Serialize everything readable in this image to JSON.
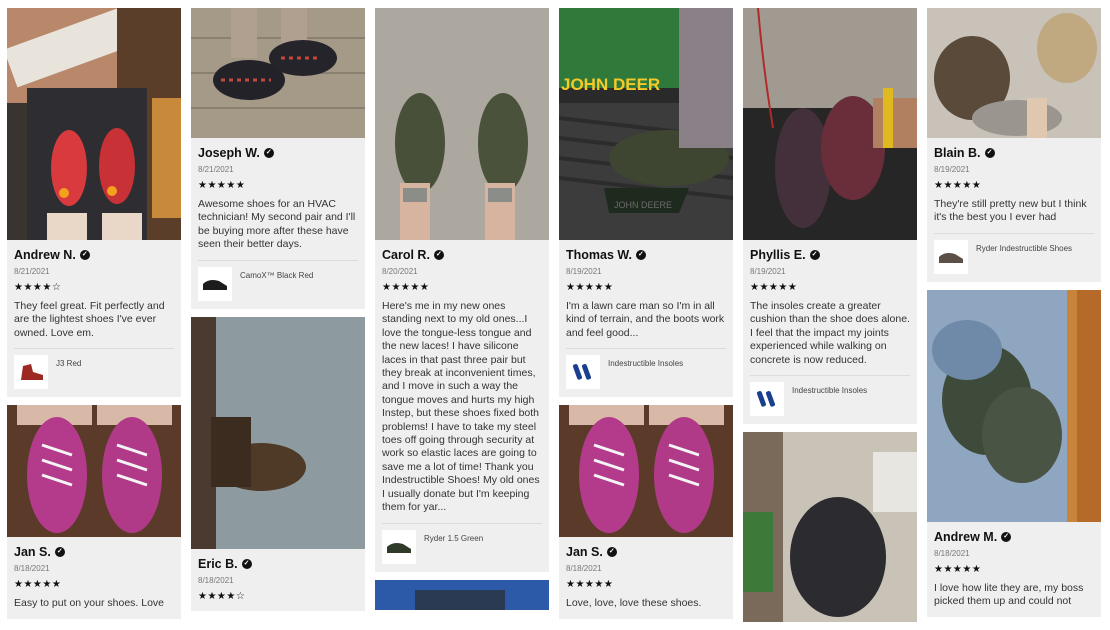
{
  "reviews": [
    {
      "name": "Andrew N.",
      "date": "8/21/2021",
      "stars": "★★★★☆",
      "text": "They feel great. Fit perfectly and are the lightest shoes I've ever owned. Love em.",
      "product": "J3 Red"
    },
    {
      "name": "Jan S.",
      "date": "8/18/2021",
      "stars": "★★★★★",
      "text": "Easy to put on your shoes. Love"
    },
    {
      "name": "Joseph W.",
      "date": "8/21/2021",
      "stars": "★★★★★",
      "text": "Awesome shoes for an HVAC technician! My second pair and I'll be buying more after these have seen their better days.",
      "product": "CamoX™ Black Red"
    },
    {
      "name": "Eric B.",
      "date": "8/18/2021",
      "stars": "★★★★☆"
    },
    {
      "name": "Carol R.",
      "date": "8/20/2021",
      "stars": "★★★★★",
      "text": "Here's me in my new ones standing next to my old ones...I love the tongue-less tongue and the new laces! I have silicone laces in that past three pair but they break at inconvenient times, and I move in such a way the tongue moves and hurts my high Instep, but these shoes fixed both problems! I have to take my steel toes off going through security at work so elastic laces are going to save me a lot of time! Thank you Indestructible Shoes! My old ones I usually donate but I'm keeping them for yar...",
      "product": "Ryder 1.5 Green"
    },
    {
      "name": "Thomas W.",
      "date": "8/19/2021",
      "stars": "★★★★★",
      "text": "I'm a lawn care man so I'm in all kind of terrain, and the boots work and feel good...",
      "product": "Indestructible Insoles"
    },
    {
      "name": "Jan S.",
      "date": "8/18/2021",
      "stars": "★★★★★",
      "text": "Love, love, love these shoes."
    },
    {
      "name": "Phyllis E.",
      "date": "8/19/2021",
      "stars": "★★★★★",
      "text": "The insoles create a greater cushion than the shoe does alone. I feel that the impact my joints experienced while walking on concrete is now reduced.",
      "product": "Indestructible Insoles"
    },
    {
      "name": "Blain B.",
      "date": "8/19/2021",
      "stars": "★★★★★",
      "text": "They're still pretty new but I think it's the best you I ever had",
      "product": "Ryder Indestructible Shoes"
    },
    {
      "name": "Andrew M.",
      "date": "8/18/2021",
      "stars": "★★★★★",
      "text": "I love how lite they are, my boss picked them up and could not"
    }
  ],
  "verified_icon": "check-circle-icon",
  "photo_text": {
    "deere_top": "JOHN DEER",
    "deere_mat": "JOHN DEERE"
  }
}
